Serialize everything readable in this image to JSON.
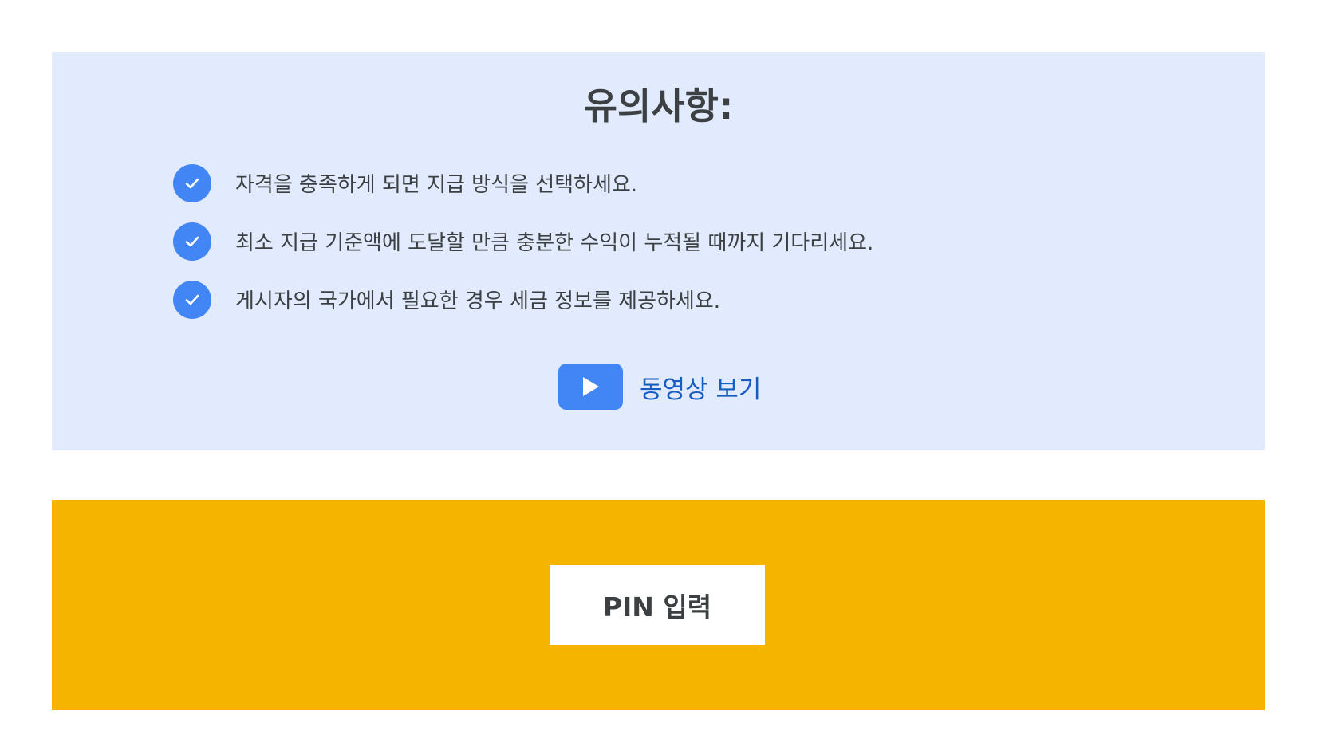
{
  "notes": {
    "title": "유의사항:",
    "items": [
      {
        "text": "자격을 충족하게 되면 지급 방식을 선택하세요.",
        "icon": "check-icon"
      },
      {
        "text": "최소 지급 기준액에 도달할 만큼 충분한 수익이 누적될 때까지 기다리세요.",
        "icon": "check-icon"
      },
      {
        "text": "게시자의 국가에서 필요한 경우 세금 정보를 제공하세요.",
        "icon": "check-icon"
      }
    ],
    "video_link": {
      "label": "동영상 보기",
      "icon": "play-icon"
    }
  },
  "pin": {
    "button_label": "PIN 입력"
  },
  "colors": {
    "notes_background": "#e1ebfd",
    "accent_blue": "#4285f4",
    "link_blue": "#1a5dc0",
    "pin_background": "#f4b400",
    "text_dark": "#3c4043"
  }
}
